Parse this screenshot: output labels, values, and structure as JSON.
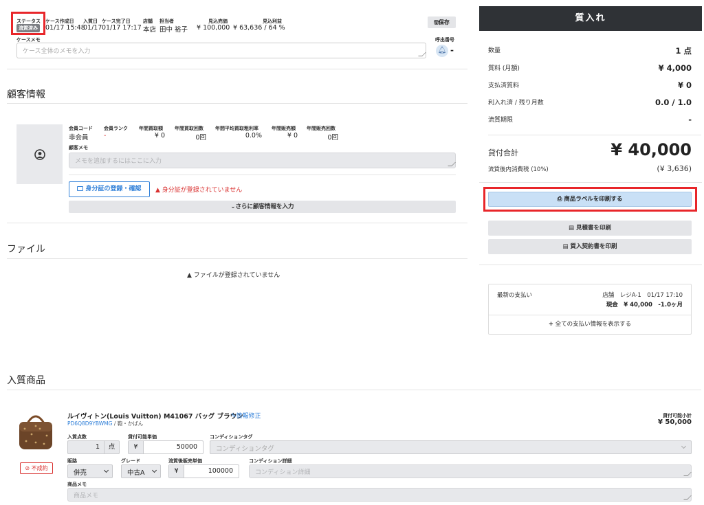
{
  "case": {
    "status_label": "ステータス",
    "status_badge": "流質済み",
    "created_label": "ケース作成日",
    "created_value": "01/17 15:48",
    "entry_label": "入質日",
    "entry_value": "01/17",
    "completed_label": "ケース完了日",
    "completed_value": "01/17 17:17",
    "store_label": "店舗",
    "store_value": "本店",
    "staff_label": "担当者",
    "staff_value": "田中 裕子",
    "est_sales_label": "見込売価",
    "est_sales_value": "¥ 100,000",
    "est_profit_label": "見込利益",
    "est_profit_value": "¥ 63,636 / 64 %",
    "save_label": "保存",
    "memo_label": "ケースメモ",
    "memo_placeholder": "ケース全体のメモを入力",
    "call_number_label": "呼出番号",
    "call_number_value": "-"
  },
  "customer": {
    "title": "顧客情報",
    "member_code_label": "会員コード",
    "member_code_value": "非会員",
    "member_rank_label": "会員ランク",
    "member_rank_value": "-",
    "annual_buy_amount_label": "年間買取額",
    "annual_buy_amount_value": "¥ 0",
    "annual_buy_count_label": "年間買取回数",
    "annual_buy_count_value": "0回",
    "annual_avg_rate_label": "年間平均買取粗利率",
    "annual_avg_rate_value": "0.0%",
    "annual_sales_amount_label": "年間販売額",
    "annual_sales_amount_value": "¥ 0",
    "annual_sales_count_label": "年間販売回数",
    "annual_sales_count_value": "0回",
    "memo_label": "顧客メモ",
    "memo_placeholder": "メモを追加するにはここに入力",
    "id_button": "身分証の登録・確認",
    "id_warning": "身分証が登録されていません",
    "more_button": "さらに顧客情報を入力"
  },
  "files": {
    "title": "ファイル",
    "empty": "ファイルが登録されていません"
  },
  "summary": {
    "header": "質入れ",
    "qty_label": "数量",
    "qty_value": "1 点",
    "fee_label": "質料 (月額)",
    "fee_value": "¥ 4,000",
    "paid_fee_label": "支払済質料",
    "paid_fee_value": "¥ 0",
    "months_label": "利入れ済 / 残り月数",
    "months_value": "0.0 / 1.0",
    "deadline_label": "流質期限",
    "deadline_value": "-",
    "loan_total_label": "貸付合計",
    "loan_total_value": "¥ 40,000",
    "tax_label": "流質後内消費税 (10%)",
    "tax_value": "(¥ 3,636)",
    "print_label_button": "商品ラベルを印刷する",
    "print_estimate_button": "見積書を印刷",
    "print_contract_button": "質入契約書を印刷",
    "latest_payment_label": "最新の支払い",
    "latest_payment_line1": "店舗　レジA-1　01/17 17:10",
    "latest_payment_line2": "現金　¥ 40,000　-1.0ヶ月",
    "show_all_payments": "全ての支払い情報を表示する"
  },
  "items": {
    "title": "入質商品",
    "rows": [
      {
        "name": "ルイヴィトン(Louis Vuitton) M41067 バッグ ブラウン",
        "edit_link": "情報修正",
        "code": "PD6Q8D9YBWMG",
        "category": " / 鞄・かばん",
        "not_contracted": "不成約",
        "subtotal_label": "貸付可能小計",
        "subtotal_value": "¥ 50,000",
        "qty_label": "入質点数",
        "qty_value": "1",
        "qty_unit": "点",
        "unit_price_label": "貸付可能単価",
        "currency": "¥",
        "unit_price_value": "50000",
        "condition_tag_label": "コンディションタグ",
        "condition_tag_placeholder": "コンディションタグ",
        "channel_label": "販路",
        "channel_value": "併売",
        "grade_label": "グレード",
        "grade_value": "中古A",
        "post_price_label": "流質後販売単価",
        "post_price_value": "100000",
        "condition_detail_label": "コンディション詳細",
        "condition_detail_placeholder": "コンディション詳細",
        "memo_label": "商品メモ",
        "memo_placeholder": "商品メモ"
      }
    ]
  },
  "colors": {
    "highlight_red": "#e8262a",
    "header_dark": "#2f3236",
    "primary_light": "#c9e0f6",
    "link_blue": "#2f7fd8",
    "warning_red": "#d9302f"
  }
}
